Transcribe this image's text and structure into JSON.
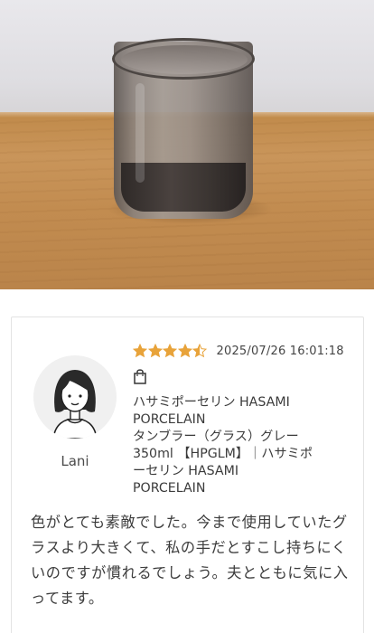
{
  "review": {
    "rating": 4.5,
    "rating_max": 5,
    "date": "2025/07/26 16:01:18",
    "reviewer_name": "Lani",
    "product_name": "ハサミポーセリン HASAMI\nPORCELAIN\nタンブラー（グラス）グレー\n350ml 【HPGLM】｜ハサミポ\nーセリン HASAMI\nPORCELAIN",
    "body": "色がとても素敵でした。今まで使用していたグラスより大きくて、私の手だとすこし持ちにくいのですが慣れるでしょう。夫とともに気に入ってます。"
  },
  "icons": {
    "star": "star-icon",
    "bag": "shopping-bag-icon",
    "avatar": "woman-avatar-icon"
  },
  "colors": {
    "star_fill": "#e8a33a",
    "star_empty": "#ffffff",
    "star_outline": "#e8a33a",
    "text": "#3b3b3b",
    "card_border": "#e3e3e3"
  }
}
